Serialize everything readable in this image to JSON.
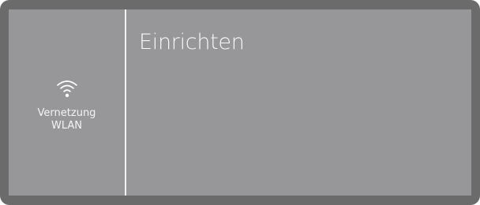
{
  "left_panel": {
    "icon": "wifi-icon",
    "line1": "Vernetzung",
    "line2": "WLAN"
  },
  "main": {
    "title": "Einrichten"
  },
  "colors": {
    "bezel": "#6b6b6b",
    "screen": "#97979a",
    "text": "#f4f4f4",
    "divider": "#f2f2f2"
  }
}
